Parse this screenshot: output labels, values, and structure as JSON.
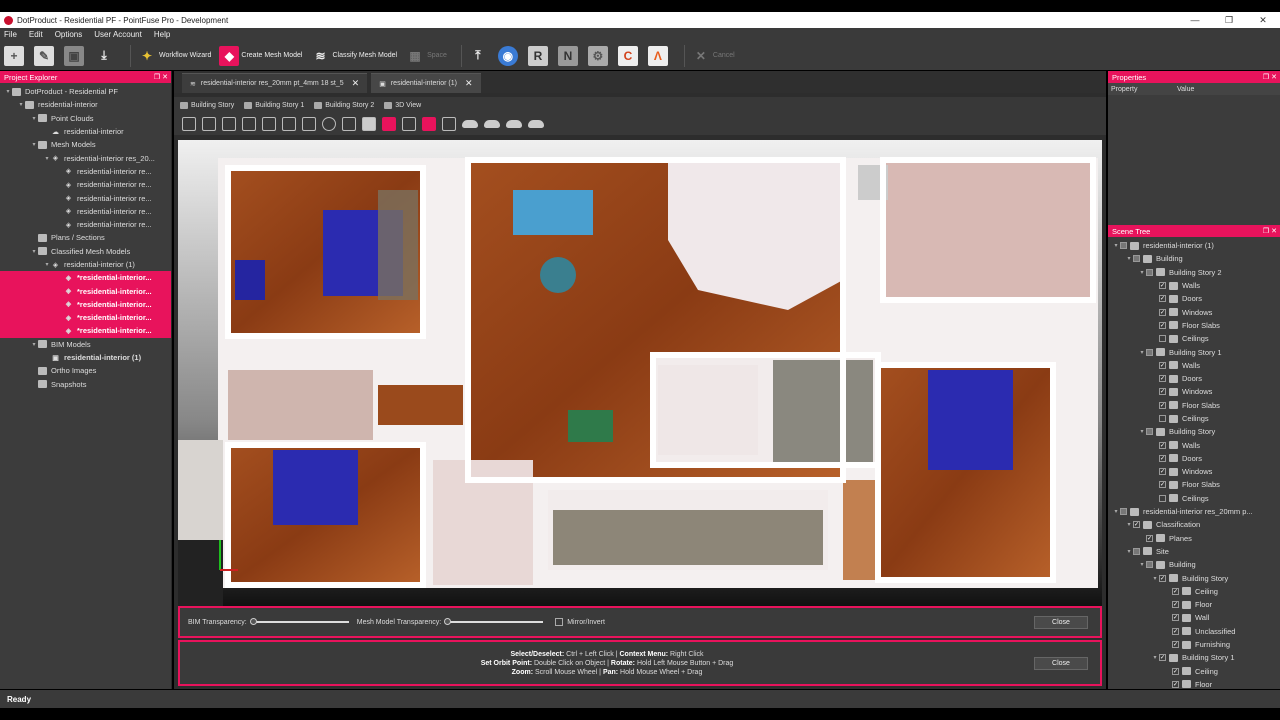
{
  "window": {
    "title": "DotProduct - Residential PF - PointFuse Pro - Development",
    "min": "—",
    "max": "❐",
    "close": "✕"
  },
  "menu": [
    "File",
    "Edit",
    "Options",
    "User Account",
    "Help"
  ],
  "toolbar": {
    "workflow_wizard": "Workflow Wizard",
    "create_mesh_model": "Create Mesh Model",
    "classify_mesh_model": "Classify Mesh Model",
    "space": "Space",
    "cancel": "Cancel"
  },
  "project_explorer": {
    "title": "Project Explorer",
    "items": [
      {
        "label": "DotProduct - Residential PF",
        "indent": 0,
        "arrow": "▾",
        "icon": "folder"
      },
      {
        "label": "residential-interior",
        "indent": 1,
        "arrow": "▾",
        "icon": "folder"
      },
      {
        "label": "Point Clouds",
        "indent": 2,
        "arrow": "▾",
        "icon": "folder"
      },
      {
        "label": "residential-interior",
        "indent": 3,
        "arrow": "",
        "icon": "cloud"
      },
      {
        "label": "Mesh Models",
        "indent": 2,
        "arrow": "▾",
        "icon": "folder"
      },
      {
        "label": "residential-interior res_20...",
        "indent": 3,
        "arrow": "▾",
        "icon": "mesh"
      },
      {
        "label": "residential-interior re...",
        "indent": 4,
        "arrow": "",
        "icon": "mesh"
      },
      {
        "label": "residential-interior re...",
        "indent": 4,
        "arrow": "",
        "icon": "mesh"
      },
      {
        "label": "residential-interior re...",
        "indent": 4,
        "arrow": "",
        "icon": "mesh"
      },
      {
        "label": "residential-interior re...",
        "indent": 4,
        "arrow": "",
        "icon": "mesh"
      },
      {
        "label": "residential-interior re...",
        "indent": 4,
        "arrow": "",
        "icon": "mesh"
      },
      {
        "label": "Plans / Sections",
        "indent": 2,
        "arrow": "",
        "icon": "folder"
      },
      {
        "label": "Classified Mesh Models",
        "indent": 2,
        "arrow": "▾",
        "icon": "folder"
      },
      {
        "label": "residential-interior (1)",
        "indent": 3,
        "arrow": "▾",
        "icon": "mesh"
      },
      {
        "label": "*residential-interior...",
        "indent": 4,
        "arrow": "",
        "icon": "mesh",
        "selected": true
      },
      {
        "label": "*residential-interior...",
        "indent": 4,
        "arrow": "",
        "icon": "mesh",
        "selected": true
      },
      {
        "label": "*residential-interior...",
        "indent": 4,
        "arrow": "",
        "icon": "mesh",
        "selected": true
      },
      {
        "label": "*residential-interior...",
        "indent": 4,
        "arrow": "",
        "icon": "mesh",
        "selected": true
      },
      {
        "label": "*residential-interior...",
        "indent": 4,
        "arrow": "",
        "icon": "mesh",
        "selected": true
      },
      {
        "label": "BIM Models",
        "indent": 2,
        "arrow": "▾",
        "icon": "folder"
      },
      {
        "label": "residential-interior (1)",
        "indent": 3,
        "arrow": "",
        "icon": "bim",
        "bold": true
      },
      {
        "label": "Ortho Images",
        "indent": 2,
        "arrow": "",
        "icon": "folder"
      },
      {
        "label": "Snapshots",
        "indent": 2,
        "arrow": "",
        "icon": "folder"
      }
    ]
  },
  "doc_tabs": [
    {
      "label": "residential-interior res_20mm pt_4mm 18 st_5",
      "close": "✕"
    },
    {
      "label": "residential-interior (1)",
      "close": "✕"
    }
  ],
  "view_tabs": [
    "Building Story",
    "Building Story 1",
    "Building Story 2",
    "3D View"
  ],
  "transparency": {
    "bim_label": "BIM Transparency:",
    "bim_value": 0,
    "mesh_label": "Mesh Model Transparency:",
    "mesh_value": 0,
    "mirror_label": "Mirror/Invert",
    "close": "Close"
  },
  "help": {
    "line1_a": "Select/Deselect:",
    "line1_b": " Ctrl + Left Click | ",
    "line1_c": "Context Menu:",
    "line1_d": " Right Click",
    "line2_a": "Set Orbit Point:",
    "line2_b": " Double Click on Object | ",
    "line2_c": "Rotate:",
    "line2_d": " Hold Left Mouse Button + Drag",
    "line3_a": "Zoom:",
    "line3_b": " Scroll Mouse Wheel | ",
    "line3_c": "Pan:",
    "line3_d": " Hold Mouse Wheel + Drag",
    "close": "Close"
  },
  "properties": {
    "title": "Properties",
    "col_property": "Property",
    "col_value": "Value"
  },
  "scene_tree": {
    "title": "Scene Tree",
    "items": [
      {
        "label": "residential-interior (1)",
        "indent": 0,
        "arrow": "▾",
        "check": "partial"
      },
      {
        "label": "Building",
        "indent": 1,
        "arrow": "▾",
        "check": "partial"
      },
      {
        "label": "Building Story 2",
        "indent": 2,
        "arrow": "▾",
        "check": "partial"
      },
      {
        "label": "Walls",
        "indent": 3,
        "arrow": "",
        "check": "on"
      },
      {
        "label": "Doors",
        "indent": 3,
        "arrow": "",
        "check": "on"
      },
      {
        "label": "Windows",
        "indent": 3,
        "arrow": "",
        "check": "on"
      },
      {
        "label": "Floor Slabs",
        "indent": 3,
        "arrow": "",
        "check": "on"
      },
      {
        "label": "Ceilings",
        "indent": 3,
        "arrow": "",
        "check": "off"
      },
      {
        "label": "Building Story 1",
        "indent": 2,
        "arrow": "▾",
        "check": "partial"
      },
      {
        "label": "Walls",
        "indent": 3,
        "arrow": "",
        "check": "on"
      },
      {
        "label": "Doors",
        "indent": 3,
        "arrow": "",
        "check": "on"
      },
      {
        "label": "Windows",
        "indent": 3,
        "arrow": "",
        "check": "on"
      },
      {
        "label": "Floor Slabs",
        "indent": 3,
        "arrow": "",
        "check": "on"
      },
      {
        "label": "Ceilings",
        "indent": 3,
        "arrow": "",
        "check": "off"
      },
      {
        "label": "Building Story",
        "indent": 2,
        "arrow": "▾",
        "check": "partial"
      },
      {
        "label": "Walls",
        "indent": 3,
        "arrow": "",
        "check": "on"
      },
      {
        "label": "Doors",
        "indent": 3,
        "arrow": "",
        "check": "on"
      },
      {
        "label": "Windows",
        "indent": 3,
        "arrow": "",
        "check": "on"
      },
      {
        "label": "Floor Slabs",
        "indent": 3,
        "arrow": "",
        "check": "on"
      },
      {
        "label": "Ceilings",
        "indent": 3,
        "arrow": "",
        "check": "off"
      },
      {
        "label": "residential-interior res_20mm p...",
        "indent": 0,
        "arrow": "▾",
        "check": "partial"
      },
      {
        "label": "Classification",
        "indent": 1,
        "arrow": "▾",
        "check": "on"
      },
      {
        "label": "Planes",
        "indent": 2,
        "arrow": "",
        "check": "on"
      },
      {
        "label": "Site",
        "indent": 1,
        "arrow": "▾",
        "check": "partial"
      },
      {
        "label": "Building",
        "indent": 2,
        "arrow": "▾",
        "check": "partial"
      },
      {
        "label": "Building Story",
        "indent": 3,
        "arrow": "▾",
        "check": "on"
      },
      {
        "label": "Ceiling",
        "indent": 4,
        "arrow": "",
        "check": "on"
      },
      {
        "label": "Floor",
        "indent": 4,
        "arrow": "",
        "check": "on"
      },
      {
        "label": "Wall",
        "indent": 4,
        "arrow": "",
        "check": "on"
      },
      {
        "label": "Unclassified",
        "indent": 4,
        "arrow": "",
        "check": "on"
      },
      {
        "label": "Furnishing",
        "indent": 4,
        "arrow": "",
        "check": "on"
      },
      {
        "label": "Building Story 1",
        "indent": 3,
        "arrow": "▾",
        "check": "on"
      },
      {
        "label": "Ceiling",
        "indent": 4,
        "arrow": "",
        "check": "on"
      },
      {
        "label": "Floor",
        "indent": 4,
        "arrow": "",
        "check": "on"
      }
    ]
  },
  "status": "Ready",
  "colors": {
    "accent": "#e8135c",
    "panel": "#3c3c3c",
    "floor_wood": "#9a4a1c",
    "bed_blue": "#2b2bb0",
    "teal": "#4a9fcf"
  }
}
